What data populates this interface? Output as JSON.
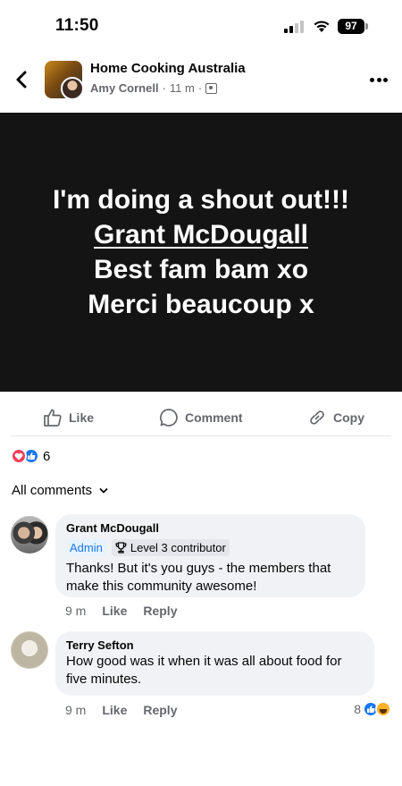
{
  "status_bar": {
    "time": "11:50",
    "battery": "97"
  },
  "header": {
    "group_name": "Home Cooking Australia",
    "author": "Amy Cornell",
    "separator": "·",
    "time_ago": "11 m",
    "separator2": "·"
  },
  "post": {
    "lines": [
      "I'm doing a shout out!!!",
      "Grant McDougall",
      "Best fam bam xo",
      "Merci beaucoup x"
    ],
    "background": "#141414"
  },
  "actions": {
    "like": "Like",
    "comment": "Comment",
    "copy": "Copy"
  },
  "reactions": {
    "count": "6",
    "types": [
      "love",
      "like"
    ]
  },
  "comments_filter": {
    "label": "All comments"
  },
  "comments": [
    {
      "name": "Grant McDougall",
      "badges": [
        "Admin",
        "Level 3 contributor"
      ],
      "text": "Thanks! But it's you guys - the members that make this community awesome!",
      "time": "9 m",
      "like": "Like",
      "reply": "Reply"
    },
    {
      "name": "Terry Sefton",
      "text": "How good was it when it was all about food for five minutes.",
      "time": "9 m",
      "like": "Like",
      "reply": "Reply",
      "reaction_count": "8",
      "reaction_types": [
        "like",
        "haha"
      ]
    }
  ],
  "colors": {
    "accent": "#1877f2",
    "love": "#f33e58",
    "muted": "#65676b",
    "bubble": "#f0f2f5"
  }
}
